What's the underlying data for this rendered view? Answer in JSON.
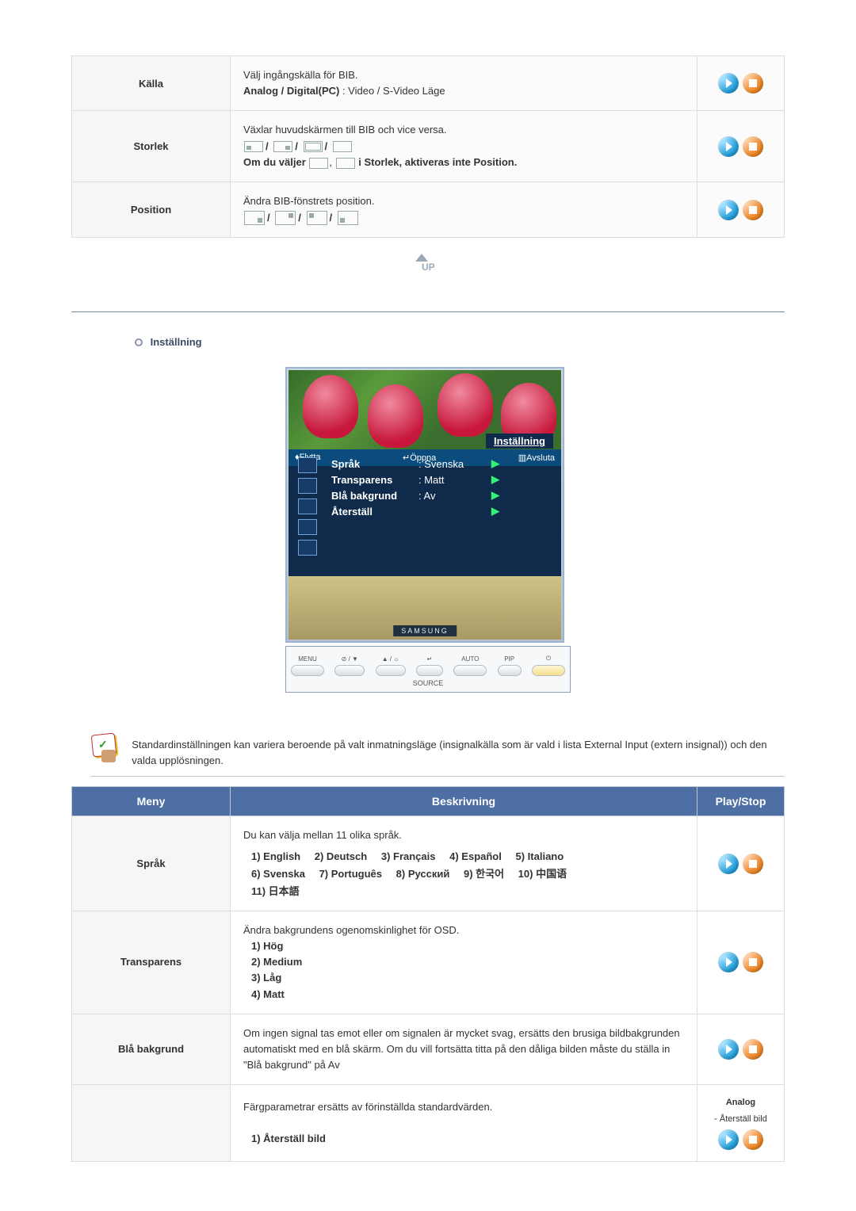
{
  "top_rows": [
    {
      "label": "Källa",
      "line1": "Välj ingångskälla för BIB.",
      "bold_prefix": "Analog / Digital(PC) ",
      "suffix": ": Video / S-Video Läge"
    },
    {
      "label": "Storlek",
      "line1": "Växlar huvudskärmen till BIB och vice versa.",
      "note_prefix": "Om du väljer ",
      "note_suffix": " i Storlek, aktiveras inte Position."
    },
    {
      "label": "Position",
      "line1": "Ändra BIB-fönstrets position."
    }
  ],
  "up_label": "UP",
  "section_title": "Inställning",
  "osd": {
    "title": "Inställning",
    "rows": [
      {
        "label": "Språk",
        "value": ": Svenska"
      },
      {
        "label": "Transparens",
        "value": ": Matt"
      },
      {
        "label": "Blå bakgrund",
        "value": ": Av"
      },
      {
        "label": "Återställ",
        "value": ""
      }
    ],
    "bottom": {
      "move": "Flytta",
      "open": "Öppna",
      "exit": "Avsluta"
    },
    "brand": "SAMSUNG"
  },
  "controls": {
    "menu": "MENU",
    "auto": "AUTO",
    "pip": "PIP",
    "source": "SOURCE",
    "sym_mute": "⊘ / ▼",
    "sym_up": "▲ / ☼",
    "sym_enter": "↵",
    "sym_pow": "⏻"
  },
  "note_text": "Standardinställningen kan variera beroende på valt inmatningsläge (insignalkälla som är vald i lista External Input (extern insignal)) och den valda upplösningen.",
  "headers": {
    "menu": "Meny",
    "desc": "Beskrivning",
    "play": "Play/Stop"
  },
  "rows": {
    "sprak": {
      "label": "Språk",
      "intro": "Du kan välja mellan 11 olika språk.",
      "langs": [
        "1) English",
        "2) Deutsch",
        "3) Français",
        "4) Español",
        "5) Italiano",
        "6) Svenska",
        "7) Português",
        "8) Русский",
        "9) 한국어",
        "10) 中国语",
        "11) 日本語"
      ]
    },
    "transparens": {
      "label": "Transparens",
      "intro": "Ändra bakgrundens ogenomskinlighet för OSD.",
      "opts": [
        "1) Hög",
        "2) Medium",
        "3) Låg",
        "4) Matt"
      ]
    },
    "bla": {
      "label": "Blå bakgrund",
      "text": "Om ingen signal tas emot eller om signalen är mycket svag, ersätts den brusiga bildbakgrunden automatiskt med en blå skärm. Om du vill fortsätta titta på den dåliga bilden måste du ställa in \"Blå bakgrund\" på Av"
    },
    "reset": {
      "intro": "Färgparametrar ersätts av förinställda standardvärden.",
      "opt1": "1) Återställ bild",
      "side_label": "Analog",
      "side_sub": "- Återställ bild"
    }
  }
}
